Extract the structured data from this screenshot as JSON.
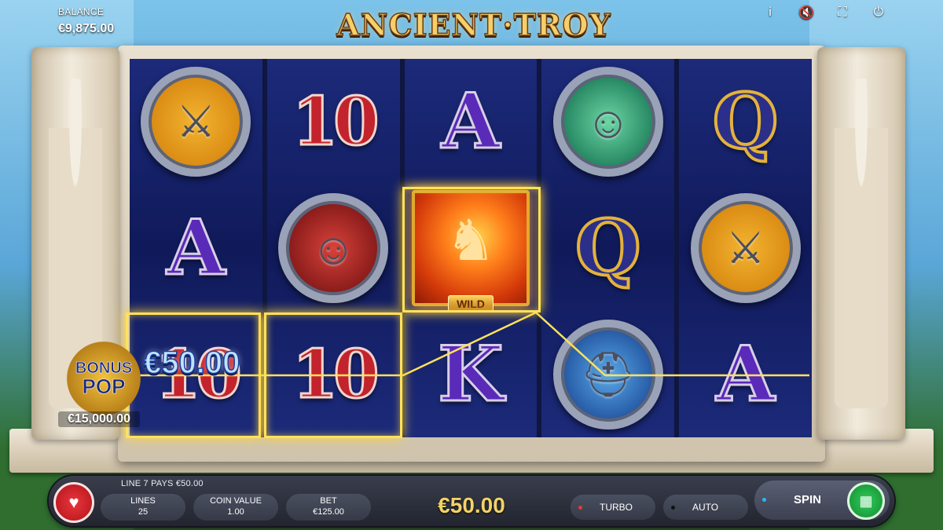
{
  "balance": {
    "label": "BALANCE",
    "value": "€9,875.00"
  },
  "logo": "ANCIENT·TROY",
  "top_icons": [
    "info-icon",
    "mute-icon",
    "fullscreen-icon",
    "power-icon"
  ],
  "reels": [
    [
      {
        "type": "medal",
        "kind": "swords",
        "glyph": "⚔"
      },
      {
        "type": "card",
        "text": "A",
        "color": "purple"
      },
      {
        "type": "card",
        "text": "10",
        "color": "red"
      }
    ],
    [
      {
        "type": "card",
        "text": "10",
        "color": "red"
      },
      {
        "type": "medal",
        "kind": "warrior",
        "glyph": "☺"
      },
      {
        "type": "card",
        "text": "10",
        "color": "red"
      }
    ],
    [
      {
        "type": "card",
        "text": "A",
        "color": "purple"
      },
      {
        "type": "wild",
        "glyph": "♞",
        "label": "WILD"
      },
      {
        "type": "card",
        "text": "K",
        "color": "purple"
      }
    ],
    [
      {
        "type": "medal",
        "kind": "woman",
        "glyph": "☺"
      },
      {
        "type": "card",
        "text": "Q",
        "color": "gold"
      },
      {
        "type": "medal",
        "kind": "helmet",
        "glyph": "⛑"
      }
    ],
    [
      {
        "type": "card",
        "text": "Q",
        "color": "gold"
      },
      {
        "type": "medal",
        "kind": "swords",
        "glyph": "⚔"
      },
      {
        "type": "card",
        "text": "A",
        "color": "purple"
      }
    ]
  ],
  "win_amount": "€50.00",
  "bonus": {
    "line1": "BONUS",
    "line2": "POP",
    "value": "€15,000.00"
  },
  "footer": {
    "line_pays": "LINE 7 PAYS €50.00",
    "lines_label": "LINES",
    "lines_value": "25",
    "coin_label": "COIN VALUE",
    "coin_value": "1.00",
    "bet_label": "BET",
    "bet_value": "€125.00",
    "total_win": "€50.00",
    "turbo": "TURBO",
    "auto": "AUTO",
    "spin": "SPIN"
  },
  "colors": {
    "win_highlight": "#ffe25a",
    "turbo_dot": "#e23a3a",
    "spin_dot": "#2fb4ff",
    "spin_button": "#2fcd5a"
  }
}
